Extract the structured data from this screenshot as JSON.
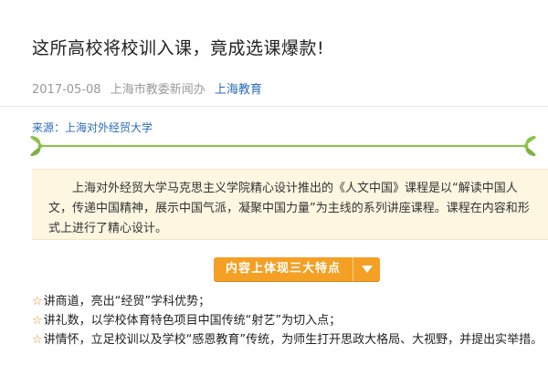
{
  "article": {
    "title": "这所高校将校训入课，竟成选课爆款!",
    "date": "2017-05-08",
    "office": "上海市教委新闻办",
    "channel": "上海教育",
    "source": "来源：上海对外经贸大学"
  },
  "intro": {
    "text": "上海对外经贸大学马克思主义学院精心设计推出的《人文中国》课程是以“解读中国人文，传递中国精神，展示中国气派，凝聚中国力量”为主线的系列讲座课程。课程在内容和形式上进行了精心设计。"
  },
  "dropdown": {
    "label": "内容上体现三大特点",
    "icon": "chevron-down-icon"
  },
  "bullets": [
    {
      "icon": "star-icon",
      "text": "讲商道，亮出“经贸”学科优势；"
    },
    {
      "icon": "star-icon",
      "text": "讲礼数，以学校体育特色项目中国传统“射艺”为切入点；"
    },
    {
      "icon": "star-icon",
      "text": "讲情怀，立足校训以及学校“感恩教育”传统，为师生打开思政大格局、大视野，并提出实举措。"
    }
  ],
  "colors": {
    "accent": "#f4a024",
    "link": "#2a6bb8",
    "vine": "#8bc34a",
    "intro_bg": "#fdf6e1"
  }
}
